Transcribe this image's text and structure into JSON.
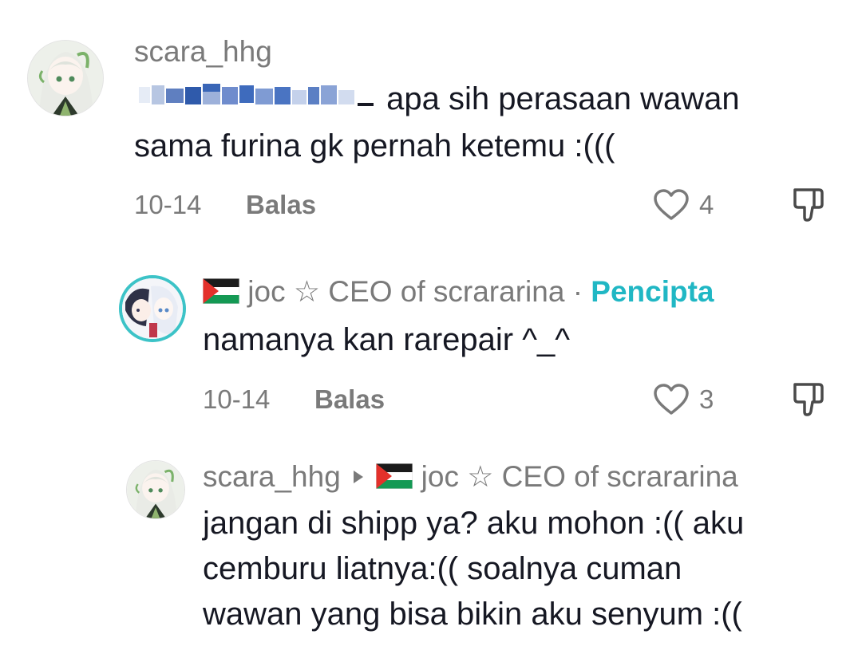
{
  "comments": [
    {
      "username": "scara_hhg",
      "mention_redacted": "▇▇▇▇▇▇▇▇_",
      "text_line1": "apa sih perasaan wawan",
      "text_line2": "sama furina gk pernah ketemu :(((",
      "date": "10-14",
      "reply_label": "Balas",
      "likes": "4"
    },
    {
      "username": "joc ☆ CEO of scrararina",
      "separator": "·",
      "creator_badge": "Pencipta",
      "text": "namanya kan rarepair ^_^",
      "date": "10-14",
      "reply_label": "Balas",
      "likes": "3"
    },
    {
      "username": "scara_hhg",
      "reply_to": "joc ☆ CEO of scrararina",
      "text_line1": "jangan di shipp ya? aku mohon :(( aku",
      "text_line2": "cemburu liatnya:(( soalnya cuman",
      "text_line3": "wawan yang bisa bikin aku senyum :(("
    }
  ],
  "colors": {
    "text_primary": "#161823",
    "text_secondary": "#7a7a7a",
    "creator_accent": "#20b7c4"
  }
}
